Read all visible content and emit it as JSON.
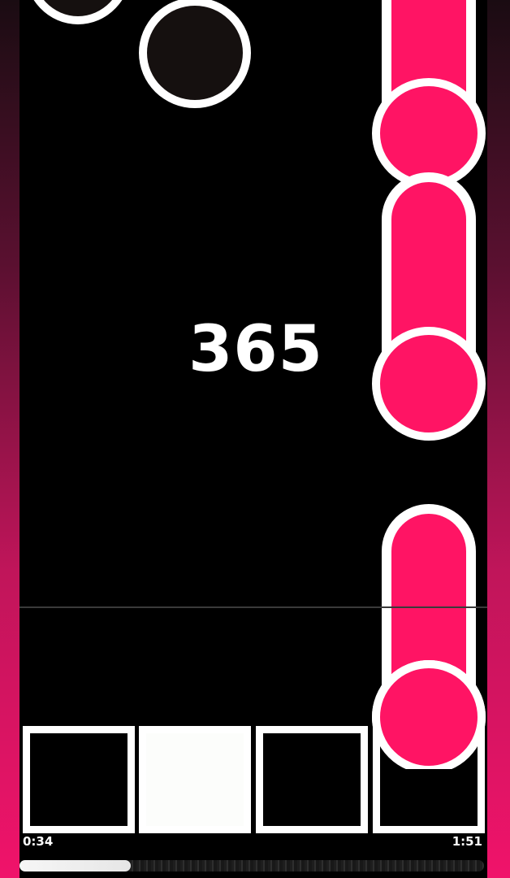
{
  "game": {
    "score": "365",
    "elapsed_time": "0:34",
    "total_time": "1:51",
    "progress_fraction": 0.24,
    "lane_count": 4,
    "pressed_lane": 2
  },
  "colors": {
    "accent": "#ff1464",
    "background": "#000000",
    "note_dark": "#15100f",
    "outline": "#ffffff"
  }
}
